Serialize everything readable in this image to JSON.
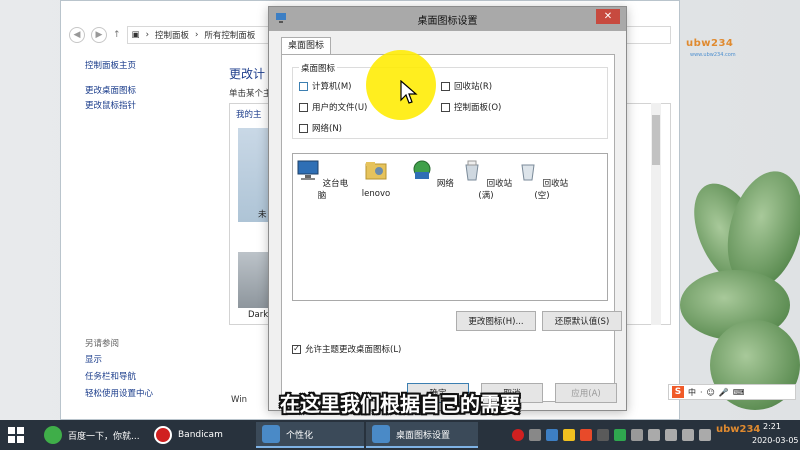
{
  "control_panel": {
    "breadcrumb": [
      "控制面板",
      "所有控制面板"
    ],
    "left_links": [
      "控制面板主页",
      "更改桌面图标",
      "更改鼠标指针"
    ],
    "see_also_heading": "另请参阅",
    "see_also_links": [
      "显示",
      "任务栏和导航",
      "轻松使用设置中心"
    ],
    "main_title": "更改计",
    "main_subtitle": "单击某个主",
    "my_themes": "我的主",
    "theme_label_1": "未",
    "theme_label_2": "Dark",
    "bottom_text": "Win"
  },
  "dialog": {
    "title": "桌面图标设置",
    "close": "✕",
    "tab": "桌面图标",
    "group_label": "桌面图标",
    "checkboxes": [
      {
        "label": "计算机(M)",
        "checked": false
      },
      {
        "label": "回收站(R)",
        "checked": false
      },
      {
        "label": "用户的文件(U)",
        "checked": false
      },
      {
        "label": "控制面板(O)",
        "checked": false
      },
      {
        "label": "网络(N)",
        "checked": false
      }
    ],
    "icons": [
      {
        "label": "这台电脑",
        "icon": "computer-icon"
      },
      {
        "label": "lenovo",
        "icon": "user-folder-icon"
      },
      {
        "label": "网络",
        "icon": "network-icon"
      },
      {
        "label": "回收站(满)",
        "icon": "recycle-bin-full-icon"
      },
      {
        "label": "回收站(空)",
        "icon": "recycle-bin-empty-icon"
      }
    ],
    "change_icon_button": "更改图标(H)...",
    "restore_default_button": "还原默认值(S)",
    "allow_themes_label": "允许主题更改桌面图标(L)",
    "allow_themes_checked": true,
    "ok_button": "确定",
    "cancel_button": "取消",
    "apply_button": "应用(A)"
  },
  "subtitle": "在这里我们根据自己的需要",
  "logo": {
    "text": "ubw234",
    "sub": "www.ubw234.com"
  },
  "ime": {
    "items": [
      "S",
      "中",
      "·",
      "☺",
      "🎤",
      "⌨"
    ]
  },
  "taskbar": {
    "items": [
      {
        "label": "百度一下，你就...",
        "icon": "ie-icon"
      },
      {
        "label": "Bandicam",
        "icon": "bandicam-icon"
      },
      {
        "label": "个性化",
        "icon": "personalize-icon"
      },
      {
        "label": "桌面图标设置",
        "icon": "desktop-icon-settings-icon"
      }
    ],
    "time": "2:21",
    "date": "2020-03-05"
  }
}
